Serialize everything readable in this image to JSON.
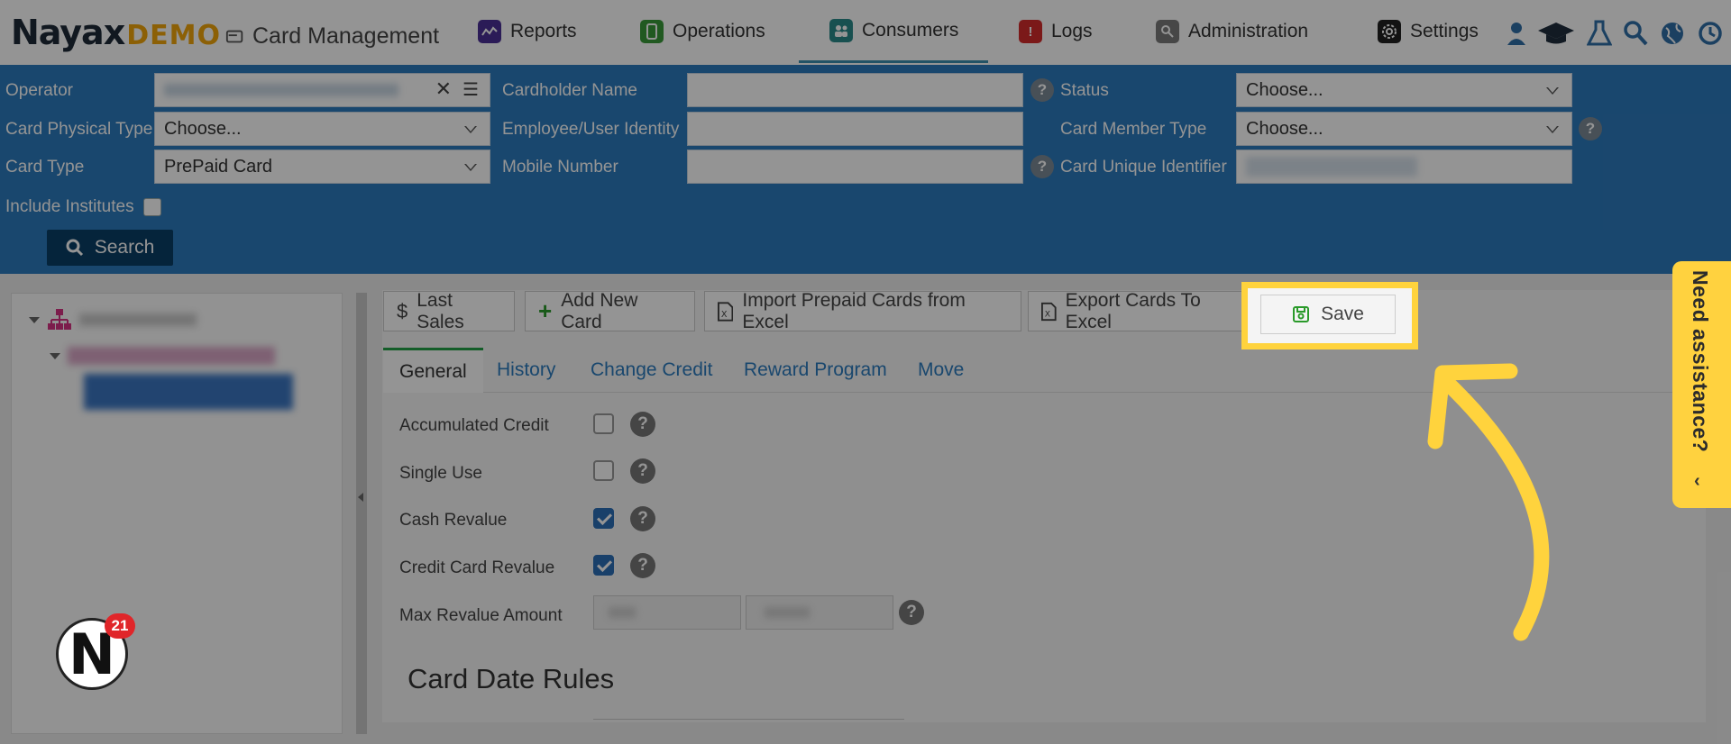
{
  "brand": {
    "logo": "Nayax",
    "demo": "DEMO",
    "app_title": "Card Management"
  },
  "nav": {
    "reports": "Reports",
    "operations": "Operations",
    "consumers": "Consumers",
    "logs": "Logs",
    "administration": "Administration",
    "settings": "Settings"
  },
  "filters": {
    "operator_label": "Operator",
    "cardholder_name_label": "Cardholder Name",
    "status_label": "Status",
    "status_value": "Choose...",
    "card_physical_type_label": "Card Physical Type",
    "card_physical_type_value": "Choose...",
    "employee_identity_label": "Employee/User Identity",
    "card_member_type_label": "Card Member Type",
    "card_member_type_value": "Choose...",
    "card_type_label": "Card Type",
    "card_type_value": "PrePaid Card",
    "mobile_number_label": "Mobile Number",
    "card_unique_identifier_label": "Card Unique Identifier",
    "include_institutes_label": "Include Institutes",
    "search_button": "Search"
  },
  "toolbar": {
    "last_sales": "Last Sales",
    "add_new_card": "Add New Card",
    "import_prepaid": "Import Prepaid Cards from Excel",
    "export_cards": "Export Cards To Excel",
    "save": "Save"
  },
  "tabs": {
    "general": "General",
    "history": "History",
    "change_credit": "Change Credit",
    "reward_program": "Reward Program",
    "move": "Move"
  },
  "fields": {
    "accumulated_credit": "Accumulated Credit",
    "single_use": "Single Use",
    "cash_revalue": "Cash Revalue",
    "credit_card_revalue": "Credit Card Revalue",
    "max_revalue_amount": "Max Revalue Amount"
  },
  "section": {
    "card_date_rules": "Card Date Rules"
  },
  "chat": {
    "badge": "21"
  },
  "assist": {
    "label": "Need assistance?"
  },
  "colors": {
    "accent_blue": "#2c7bbd",
    "highlight_yellow": "#ffd33d",
    "active_tab_green": "#24a148"
  }
}
